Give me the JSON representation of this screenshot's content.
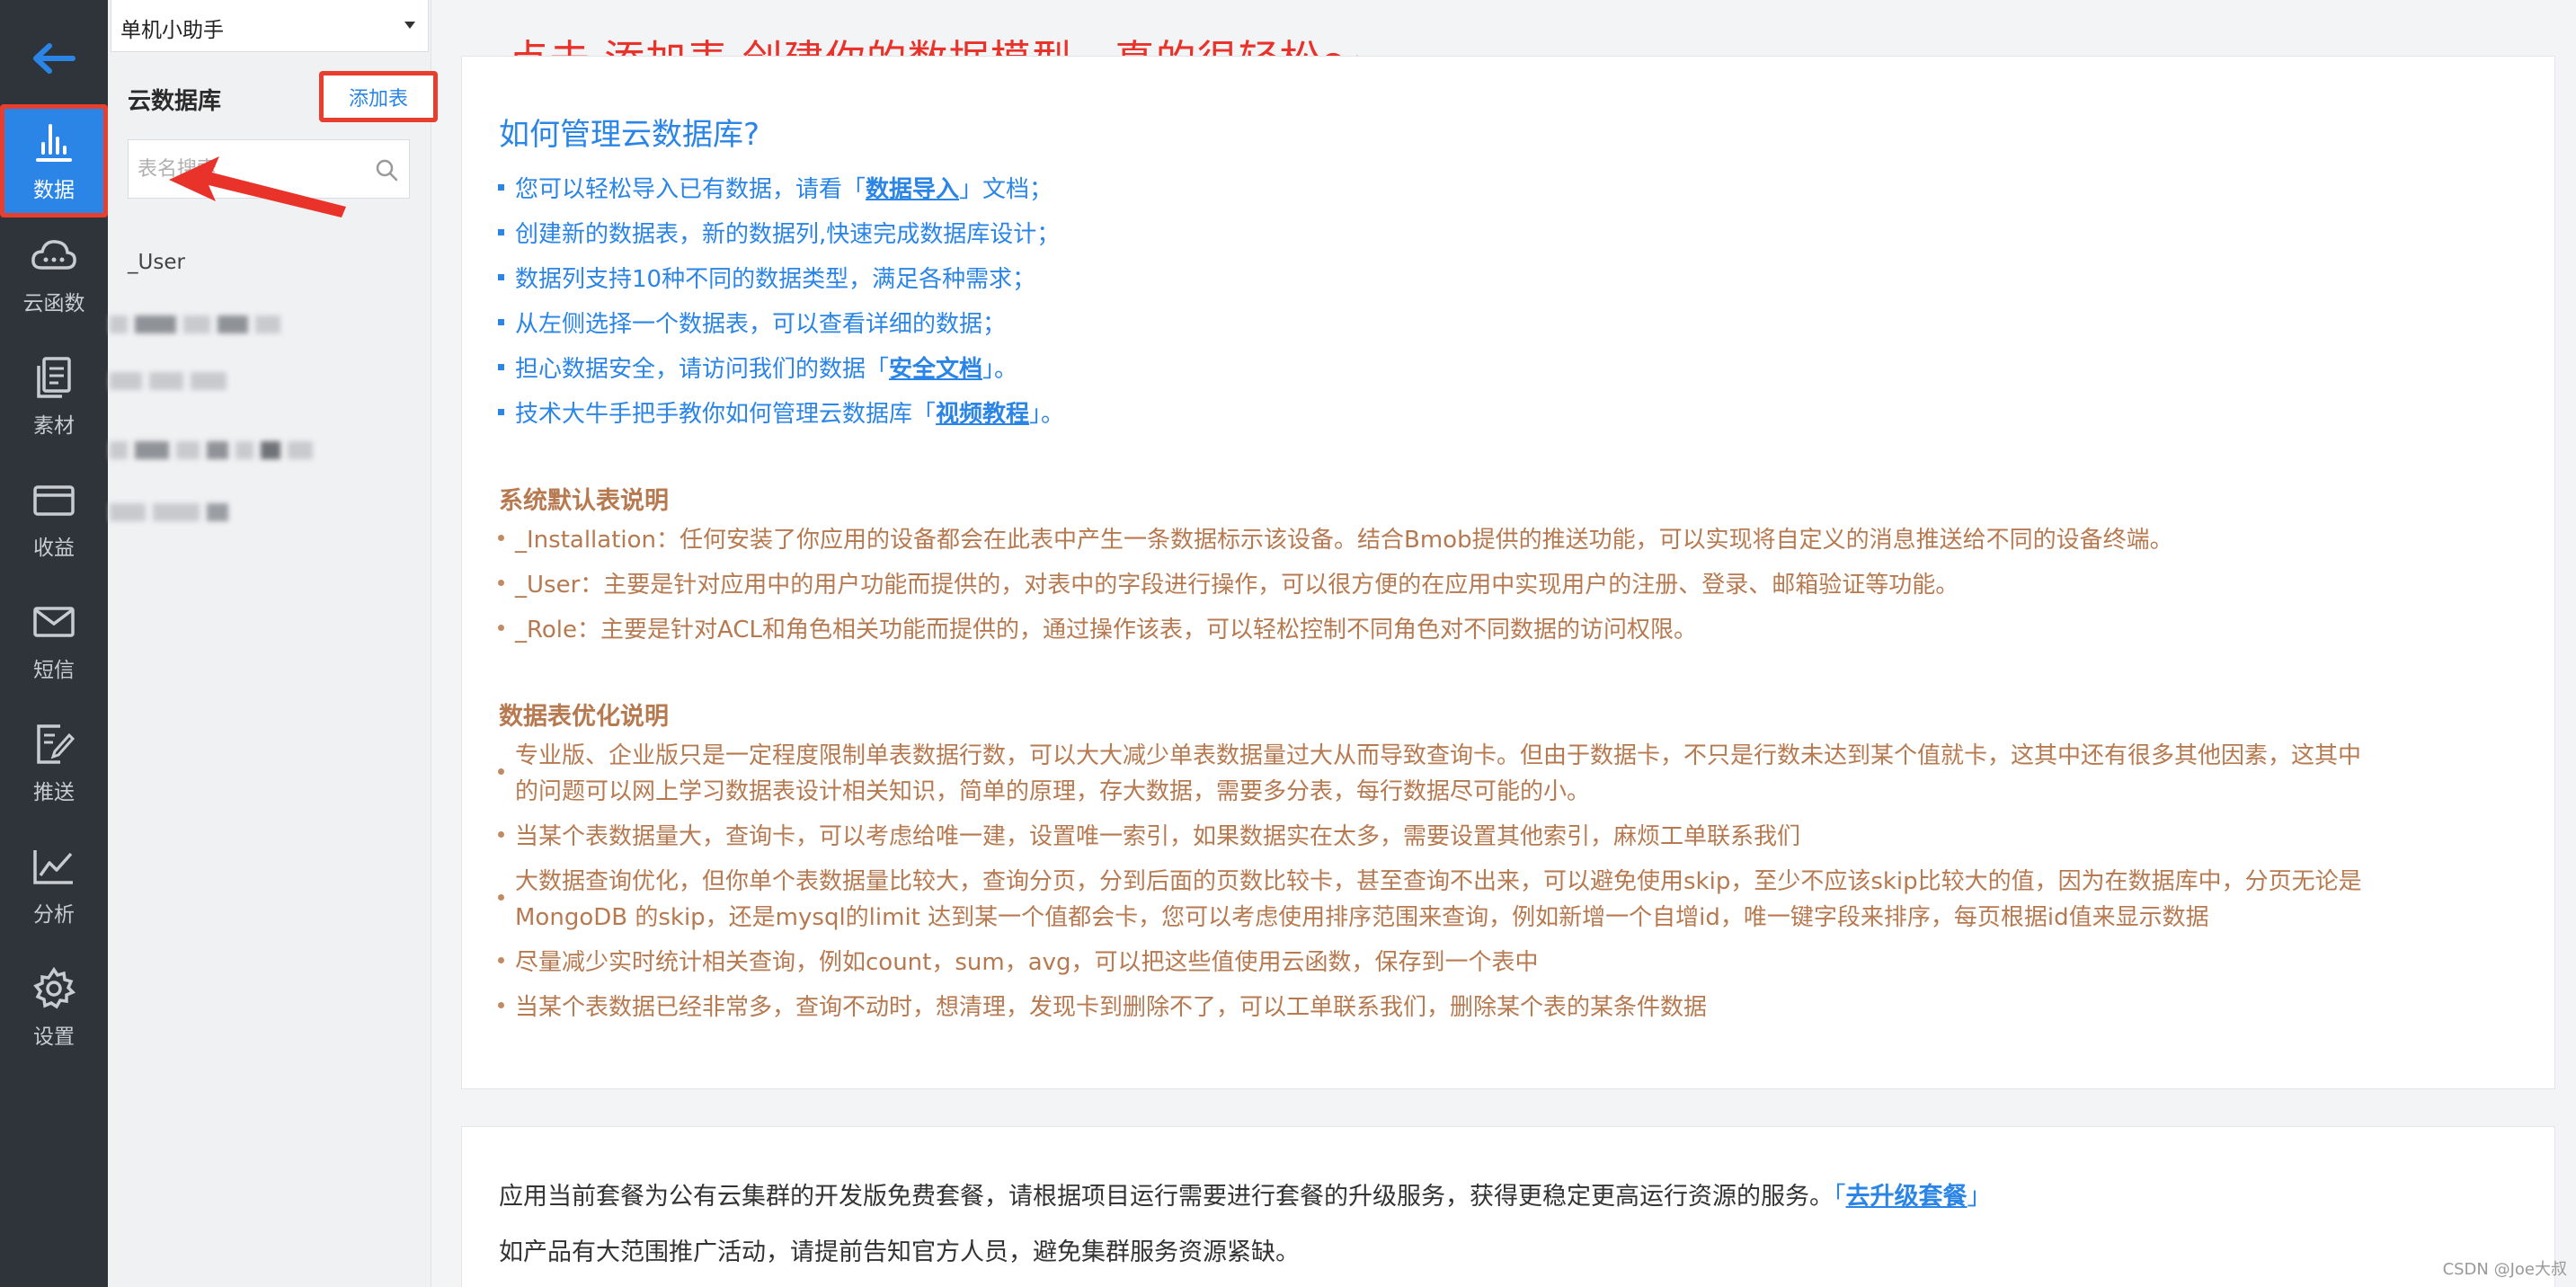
{
  "nav": {
    "items": [
      {
        "label": "数据",
        "icon": "bar-chart-icon",
        "active": true
      },
      {
        "label": "云函数",
        "icon": "cloud-icon",
        "active": false
      },
      {
        "label": "素材",
        "icon": "document-icon",
        "active": false
      },
      {
        "label": "收益",
        "icon": "wallet-icon",
        "active": false
      },
      {
        "label": "短信",
        "icon": "mail-icon",
        "active": false
      },
      {
        "label": "推送",
        "icon": "push-edit-icon",
        "active": false
      },
      {
        "label": "分析",
        "icon": "line-chart-icon",
        "active": false
      },
      {
        "label": "设置",
        "icon": "gear-icon",
        "active": false
      }
    ]
  },
  "panel": {
    "app_selected": "单机小助手",
    "title": "云数据库",
    "add_table_label": "添加表",
    "search_placeholder": "表名搜索",
    "tables": [
      "_User"
    ]
  },
  "annotation": {
    "caption": "点击 添加表 创建你的数据模型，真的很轻松～"
  },
  "guide": {
    "title": "如何管理云数据库?",
    "items": [
      {
        "pre": "您可以轻松导入已有数据，请看「",
        "link": "数据导入",
        "post": "」文档；"
      },
      {
        "pre": "创建新的数据表，新的数据列,快速完成数据库设计；",
        "link": "",
        "post": ""
      },
      {
        "pre": "数据列支持10种不同的数据类型，满足各种需求；",
        "link": "",
        "post": ""
      },
      {
        "pre": "从左侧选择一个数据表，可以查看详细的数据；",
        "link": "",
        "post": ""
      },
      {
        "pre": "担心数据安全，请访问我们的数据「",
        "link": "安全文档",
        "post": "」。"
      },
      {
        "pre": "技术大牛手把手教你如何管理云数据库「",
        "link": "视频教程",
        "post": "」。"
      }
    ]
  },
  "default_tables": {
    "title": "系统默认表说明",
    "items": [
      "_Installation：任何安装了你应用的设备都会在此表中产生一条数据标示该设备。结合Bmob提供的推送功能，可以实现将自定义的消息推送给不同的设备终端。",
      "_User：主要是针对应用中的用户功能而提供的，对表中的字段进行操作，可以很方便的在应用中实现用户的注册、登录、邮箱验证等功能。",
      "_Role：主要是针对ACL和角色相关功能而提供的，通过操作该表，可以轻松控制不同角色对不同数据的访问权限。"
    ]
  },
  "optimization": {
    "title": "数据表优化说明",
    "items": [
      {
        "l1": "专业版、企业版只是一定程度限制单表数据行数，可以大大减少单表数据量过大从而导致查询卡。但由于数据卡，不只是行数未达到某个值就卡，这其中还有很多其他因素，这其中",
        "l2": "的问题可以网上学习数据表设计相关知识，简单的原理，存大数据，需要多分表，每行数据尽可能的小。"
      },
      {
        "l1": "当某个表数据量大，查询卡，可以考虑给唯一建，设置唯一索引，如果数据实在太多，需要设置其他索引，麻烦工单联系我们",
        "l2": ""
      },
      {
        "l1": "大数据查询优化，但你单个表数据量比较大，查询分页，分到后面的页数比较卡，甚至查询不出来，可以避免使用skip，至少不应该skip比较大的值，因为在数据库中，分页无论是",
        "l2": "MongoDB 的skip，还是mysql的limit 达到某一个值都会卡，您可以考虑使用排序范围来查询，例如新增一个自增id，唯一键字段来排序，每页根据id值来显示数据"
      },
      {
        "l1": "尽量减少实时统计相关查询，例如count，sum，avg，可以把这些值使用云函数，保存到一个表中",
        "l2": ""
      },
      {
        "l1": "当某个表数据已经非常多，查询不动时，想清理，发现卡到删除不了，可以工单联系我们，删除某个表的某条件数据",
        "l2": ""
      }
    ]
  },
  "plan": {
    "line1_pre": "应用当前套餐为公有云集群的开发版免费套餐，请根据项目运行需要进行套餐的升级服务，获得更稳定更高运行资源的服务。",
    "line1_open": "「",
    "line1_link": "去升级套餐",
    "line1_close": "」",
    "line2": "如产品有大范围推广活动，请提前告知官方人员，避免集群服务资源紧缺。"
  },
  "watermark": "CSDN @Joe大叔",
  "colors": {
    "accent": "#2a85e6",
    "annotation": "#e8322a",
    "brown_text": "#b77a50",
    "nav_bg": "#2e3439"
  }
}
